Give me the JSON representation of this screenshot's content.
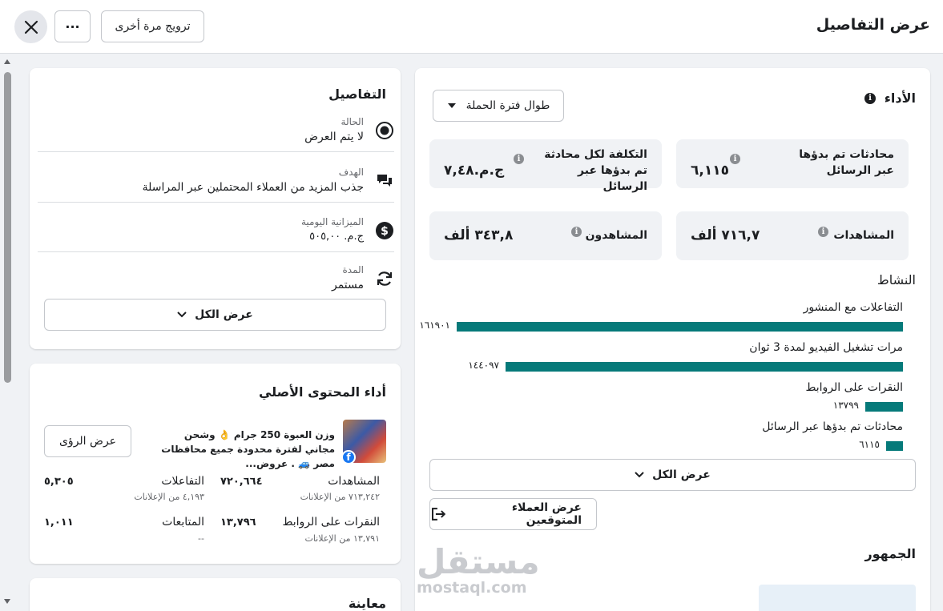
{
  "header": {
    "title": "عرض التفاصيل",
    "promote_again": "ترويج مرة أخرى",
    "more": "···"
  },
  "performance": {
    "title": "الأداء",
    "date_range": "طوال فترة الحملة",
    "stats": [
      {
        "label": "محادثات تم بدؤها عبر الرسائل",
        "value": "٦,١١٥"
      },
      {
        "label": "التكلفة لكل محادثة تم بدؤها عبر الرسائل",
        "value": "ج.م.٧,٤٨"
      },
      {
        "label": "المشاهدات",
        "value": "٧١٦,٧ ألف"
      },
      {
        "label": "المشاهدون",
        "value": "٣٤٣,٨ ألف"
      }
    ],
    "activity_title": "النشاط",
    "activity": [
      {
        "label": "التفاعلات مع المنشور",
        "value": "١٦١٩٠١",
        "count": 161901
      },
      {
        "label": "مرات تشغيل الفيديو لمدة 3 ثوان",
        "value": "١٤٤٠٩٧",
        "count": 144097
      },
      {
        "label": "النقرات على الروابط",
        "value": "١٣٧٩٩",
        "count": 13799
      },
      {
        "label": "محادثات تم بدؤها عبر الرسائل",
        "value": "٦١١٥",
        "count": 6115
      }
    ],
    "show_all": "عرض الكل",
    "view_leads": "عرض العملاء المتوقعين",
    "audience_title": "الجمهور",
    "accent_color": "#067a7a"
  },
  "details": {
    "title": "التفاصيل",
    "rows": [
      {
        "key": "الحالة",
        "value": "لا يتم العرض",
        "icon": "radio-icon"
      },
      {
        "key": "الهدف",
        "value": "جذب المزيد من العملاء المحتملين عبر المراسلة",
        "icon": "chat-icon"
      },
      {
        "key": "الميزانية اليومية",
        "value": "ج.م. ٥٠٥,٠٠",
        "icon": "dollar-icon"
      },
      {
        "key": "المدة",
        "value": "مستمر",
        "icon": "refresh-icon"
      }
    ],
    "show_all": "عرض الكل"
  },
  "original": {
    "title": "أداء المحتوى الأصلي",
    "post_text": "وزن العبوة 250 جرام 👌 وشحن مجاني لفترة محدودة جميع محافظات مصر 🚙 . عروض...",
    "view_insights": "عرض الرؤى",
    "metrics": [
      {
        "key": "المشاهدات",
        "value": "٧٢٠,٦٦٤",
        "sub": "٧١٣,٢٤٢ من الإعلانات"
      },
      {
        "key": "التفاعلات",
        "value": "٥,٣٠٥",
        "sub": "٤,١٩٣ من الإعلانات"
      },
      {
        "key": "النقرات على الروابط",
        "value": "١٣,٧٩٦",
        "sub": "١٣,٧٩١ من الإعلانات"
      },
      {
        "key": "المتابعات",
        "value": "١,٠١١",
        "sub": "--"
      }
    ]
  },
  "preview": {
    "title": "معاينة"
  },
  "watermark": {
    "brand": "مستقل",
    "domain": "mostaql.com"
  }
}
